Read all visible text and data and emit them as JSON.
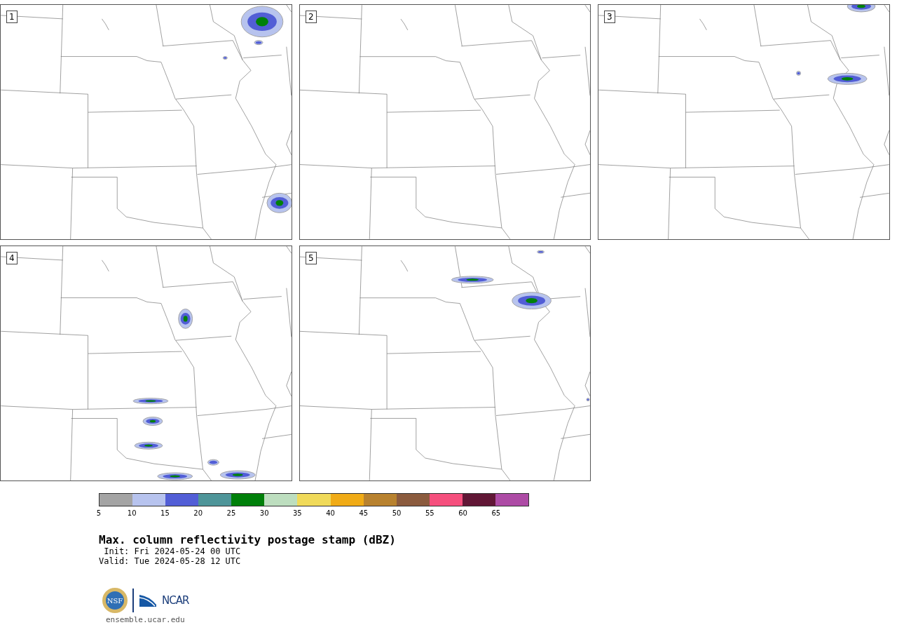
{
  "panels": [
    {
      "number": "1"
    },
    {
      "number": "2"
    },
    {
      "number": "3"
    },
    {
      "number": "4"
    },
    {
      "number": "5"
    }
  ],
  "colorbar": {
    "bins": [
      {
        "color": "#a4a4a4"
      },
      {
        "color": "#b7c3ee"
      },
      {
        "color": "#525ed6"
      },
      {
        "color": "#4e9599"
      },
      {
        "color": "#00800a"
      },
      {
        "color": "#bddebf"
      },
      {
        "color": "#f0da5a"
      },
      {
        "color": "#f0ab16"
      },
      {
        "color": "#b8822f"
      },
      {
        "color": "#8b5b3e"
      },
      {
        "color": "#f54f7d"
      },
      {
        "color": "#611736"
      },
      {
        "color": "#ad4ba5"
      }
    ],
    "ticks": [
      "5",
      "10",
      "15",
      "20",
      "25",
      "30",
      "35",
      "40",
      "45",
      "50",
      "55",
      "60",
      "65"
    ]
  },
  "title": "Max. column reflectivity postage stamp (dBZ)",
  "init": " Init: Fri 2024-05-24 00 UTC",
  "valid": "Valid: Tue 2024-05-28 12 UTC",
  "logo_nsf": "NSF",
  "logo_ncar": "NCAR",
  "footer": "ensemble.ucar.edu"
}
